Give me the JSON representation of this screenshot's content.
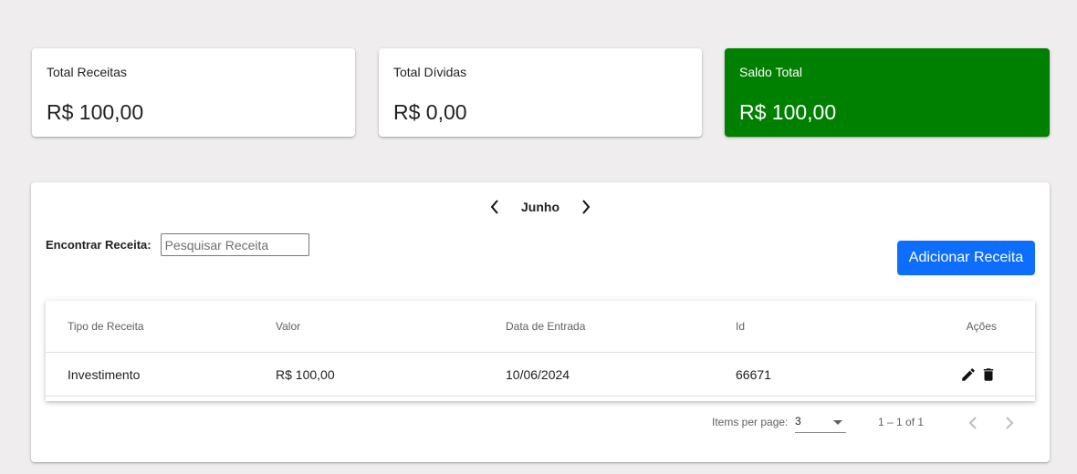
{
  "summary": {
    "receitas": {
      "title": "Total Receitas",
      "value": "R$ 100,00"
    },
    "dividas": {
      "title": "Total Dívidas",
      "value": "R$ 0,00"
    },
    "saldo": {
      "title": "Saldo Total",
      "value": "R$ 100,00",
      "color": "#008000"
    }
  },
  "month_nav": {
    "month": "Junho",
    "prev_icon": "chevron-left-icon",
    "next_icon": "chevron-right-icon"
  },
  "search": {
    "label": "Encontrar Receita:",
    "placeholder": "Pesquisar Receita",
    "value": ""
  },
  "add_button": {
    "label": "Adicionar Receita",
    "color": "#0d6efd"
  },
  "table": {
    "columns": [
      "Tipo de Receita",
      "Valor",
      "Data de Entrada",
      "Id",
      "Ações"
    ],
    "rows": [
      {
        "tipo": "Investimento",
        "valor": "R$ 100,00",
        "data": "10/06/2024",
        "id": "66671",
        "actions": [
          "edit-icon",
          "delete-icon"
        ]
      }
    ]
  },
  "paginator": {
    "items_per_page_label": "Items per page:",
    "page_size": "3",
    "range_label": "1 – 1 of 1"
  }
}
